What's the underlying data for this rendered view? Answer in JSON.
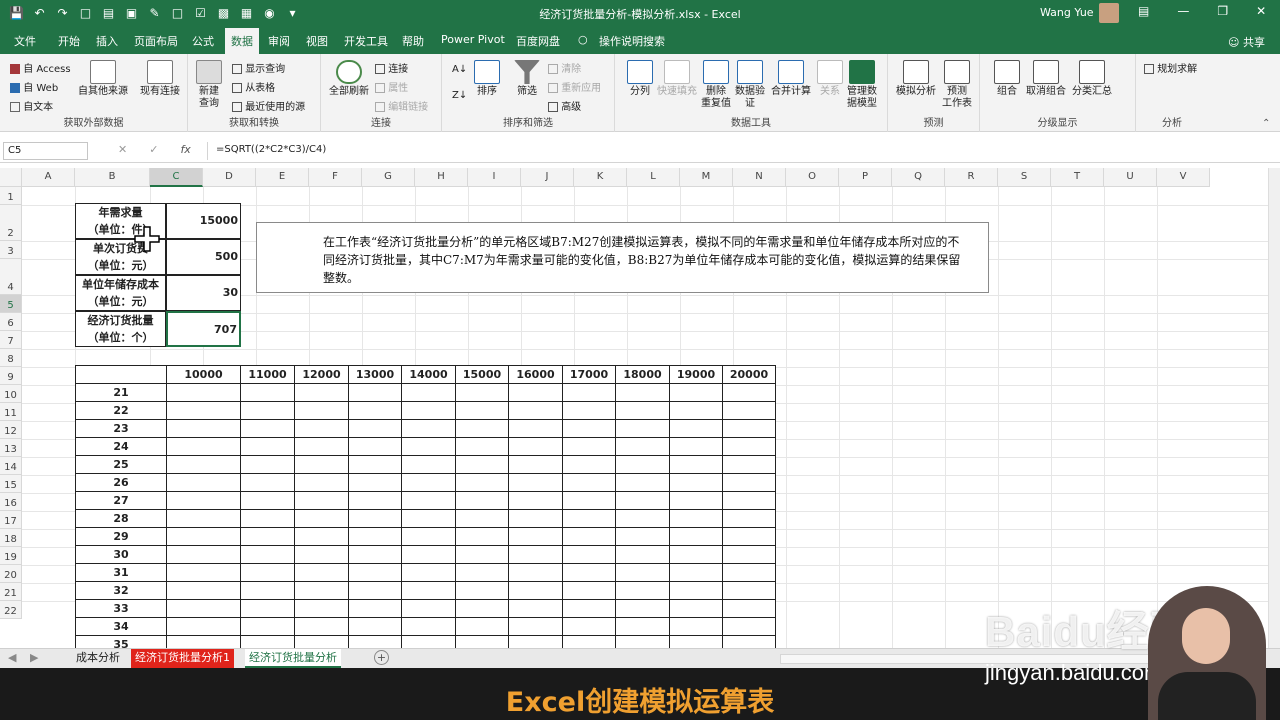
{
  "window": {
    "title": "经济订货批量分析-模拟分析.xlsx  -  Excel",
    "user": "Wang Yue"
  },
  "ribbon_tabs": [
    "文件",
    "开始",
    "插入",
    "页面布局",
    "公式",
    "数据",
    "审阅",
    "视图",
    "开发工具",
    "帮助",
    "Power Pivot",
    "百度网盘",
    "操作说明搜索"
  ],
  "active_tab": "数据",
  "share_label": "共享",
  "ribbon": {
    "get_external": {
      "access": "自 Access",
      "web": "自 Web",
      "text": "自文本",
      "other": "自其他来源",
      "existing": "现有连接",
      "label": "获取外部数据"
    },
    "get_transform": {
      "new_query": "新建\n查询",
      "show_query": "显示查询",
      "from_table": "从表格",
      "recent": "最近使用的源",
      "label": "获取和转换"
    },
    "connections": {
      "refresh_all": "全部刷新",
      "connections": "连接",
      "properties": "属性",
      "edit_links": "编辑链接",
      "label": "连接"
    },
    "sort_filter": {
      "sort": "排序",
      "filter": "筛选",
      "clear": "清除",
      "reapply": "重新应用",
      "advanced": "高级",
      "label": "排序和筛选"
    },
    "data_tools": {
      "text_to_col": "分列",
      "flash_fill": "快速填充",
      "remove_dup": "删除\n重复值",
      "validation": "数据验\n证",
      "consolidate": "合并计算",
      "relations": "关系",
      "manage_model": "管理数\n据模型",
      "label": "数据工具"
    },
    "forecast": {
      "whatif": "模拟分析",
      "forecast_sheet": "预测\n工作表",
      "label": "预测"
    },
    "outline": {
      "group": "组合",
      "ungroup": "取消组合",
      "subtotal": "分类汇总",
      "label": "分级显示"
    },
    "analysis": {
      "solver": "规划求解",
      "label": "分析"
    }
  },
  "name_box": "C5",
  "formula": "=SQRT((2*C2*C3)/C4)",
  "columns": [
    "A",
    "B",
    "C",
    "D",
    "E",
    "F",
    "G",
    "H",
    "I",
    "J",
    "K",
    "L",
    "M",
    "N",
    "O",
    "P",
    "Q",
    "R",
    "S",
    "T",
    "U",
    "V"
  ],
  "rows": [
    "1",
    "2",
    "3",
    "4",
    "5",
    "6",
    "7",
    "8",
    "9",
    "10",
    "11",
    "12",
    "13",
    "14",
    "15",
    "16",
    "17",
    "18",
    "19",
    "20",
    "21",
    "22"
  ],
  "params": [
    {
      "label1": "年需求量",
      "label2": "（单位：件）",
      "value": "15000"
    },
    {
      "label1": "单次订货费",
      "label2": "（单位：元）",
      "value": "500"
    },
    {
      "label1": "单位年储存成本",
      "label2": "（单位：元）",
      "value": "30"
    },
    {
      "label1": "经济订货批量",
      "label2": "（单位：个）",
      "value": "707"
    }
  ],
  "instruction": "在工作表“经济订货批量分析”的单元格区域B7:M27创建模拟运算表，模拟不同的年需求量和单位年储存成本所对应的不同经济订货批量，其中C7:M7为年需求量可能的变化值，B8:B27为单位年储存成本可能的变化值，模拟运算的结果保留整数。",
  "table": {
    "demand_values": [
      "10000",
      "11000",
      "12000",
      "13000",
      "14000",
      "15000",
      "16000",
      "17000",
      "18000",
      "19000",
      "20000"
    ],
    "cost_values": [
      "21",
      "22",
      "23",
      "24",
      "25",
      "26",
      "27",
      "28",
      "29",
      "30",
      "31",
      "32",
      "33",
      "34",
      "35"
    ]
  },
  "sheet_tabs": [
    "成本分析",
    "经济订货批量分析1",
    "经济订货批量分析"
  ],
  "active_sheet": "经济订货批量分析",
  "caption": "Excel创建模拟运算表",
  "watermark": {
    "brand": "Baidu经验",
    "url": "jingyan.baidu.com"
  },
  "colors": {
    "excel_green": "#217346",
    "caption_text": "#f0a030",
    "error_tab": "#e0241b"
  }
}
